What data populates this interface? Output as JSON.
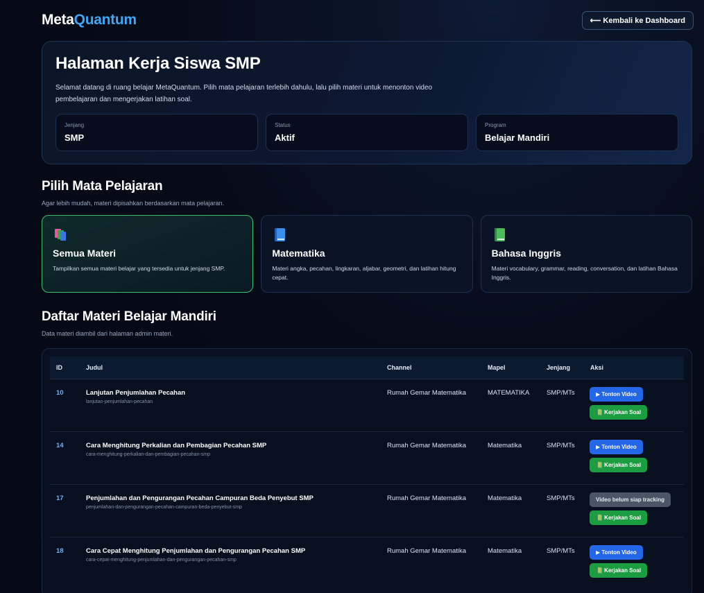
{
  "header": {
    "logo_part1": "Meta",
    "logo_part2": "Quantum",
    "back_button": "⟵ Kembali ke Dashboard"
  },
  "hero": {
    "title": "Halaman Kerja Siswa SMP",
    "description": "Selamat datang di ruang belajar MetaQuantum. Pilih mata pelajaran terlebih dahulu, lalu pilih materi untuk menonton video pembelajaran dan mengerjakan latihan soal.",
    "stats": [
      {
        "label": "Jenjang",
        "value": "SMP"
      },
      {
        "label": "Status",
        "value": "Aktif"
      },
      {
        "label": "Program",
        "value": "Belajar Mandiri"
      }
    ]
  },
  "subjects": {
    "title": "Pilih Mata Pelajaran",
    "subtitle": "Agar lebih mudah, materi dipisahkan berdasarkan mata pelajaran.",
    "cards": [
      {
        "icon": "books-stack-icon",
        "title": "Semua Materi",
        "description": "Tampilkan semua materi belajar yang tersedia untuk jenjang SMP.",
        "active": true
      },
      {
        "icon": "blue-book-icon",
        "title": "Matematika",
        "description": "Materi angka, pecahan, lingkaran, aljabar, geometri, dan latihan hitung cepat.",
        "active": false
      },
      {
        "icon": "green-book-icon",
        "title": "Bahasa Inggris",
        "description": "Materi vocabulary, grammar, reading, conversation, dan latihan Bahasa Inggris.",
        "active": false
      }
    ]
  },
  "materials": {
    "title": "Daftar Materi Belajar Mandiri",
    "subtitle": "Data materi diambil dari halaman admin materi.",
    "columns": {
      "id": "ID",
      "title": "Judul",
      "channel": "Channel",
      "subject": "Mapel",
      "level": "Jenjang",
      "action": "Aksi"
    },
    "rows": [
      {
        "id": "10",
        "title": "Lanjutan Penjumlahan Pecahan",
        "slug": "lanjutan-penjumlahan-pecahan",
        "channel": "Rumah Gemar Matematika",
        "subject": "MATEMATIKA",
        "level": "SMP/MTs",
        "video_label": "▶ Tonton Video",
        "video_ready": true,
        "work_label": "📗 Kerjakan Soal"
      },
      {
        "id": "14",
        "title": "Cara Menghitung Perkalian dan Pembagian Pecahan SMP",
        "slug": "cara-menghitung-perkalian-dan-pembagian-pecahan-smp",
        "channel": "Rumah Gemar Matematika",
        "subject": "Matematika",
        "level": "SMP/MTs",
        "video_label": "▶ Tonton Video",
        "video_ready": true,
        "work_label": "📗 Kerjakan Soal"
      },
      {
        "id": "17",
        "title": "Penjumlahan dan Pengurangan Pecahan Campuran Beda Penyebut SMP",
        "slug": "penjumlahan-dan-pengurangan-pecahan-campuran-beda-penyebut-smp",
        "channel": "Rumah Gemar Matematika",
        "subject": "Matematika",
        "level": "SMP/MTs",
        "video_label": "Video belum siap tracking",
        "video_ready": false,
        "work_label": "📗 Kerjakan Soal"
      },
      {
        "id": "18",
        "title": "Cara Cepat Menghitung Penjumlahan dan Pengurangan Pecahan SMP",
        "slug": "cara-cepat-menghitung-penjumlahan-dan-pengurangan-pecahan-smp",
        "channel": "Rumah Gemar Matematika",
        "subject": "Matematika",
        "level": "SMP/MTs",
        "video_label": "▶ Tonton Video",
        "video_ready": true,
        "work_label": "📗 Kerjakan Soal"
      }
    ]
  }
}
